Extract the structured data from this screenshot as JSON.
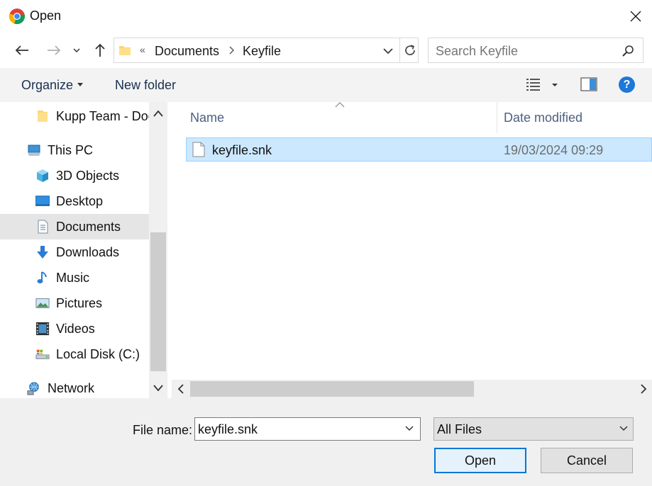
{
  "window": {
    "title": "Open",
    "app_icon": "chrome-icon",
    "close_icon": "close-icon"
  },
  "navigation": {
    "back_icon": "back-arrow-icon",
    "forward_icon": "forward-arrow-icon",
    "recent_icon": "chevron-down-icon",
    "up_icon": "up-arrow-icon"
  },
  "address": {
    "overflow": "«",
    "crumbs": [
      "Documents",
      "Keyfile"
    ],
    "refresh_icon": "refresh-icon"
  },
  "search": {
    "placeholder": "Search Keyfile"
  },
  "toolbar": {
    "organize_label": "Organize",
    "new_folder_label": "New folder",
    "help_label": "?"
  },
  "sidebar": {
    "items": [
      {
        "label": "Kupp Team - Documents",
        "icon": "folder-icon"
      },
      {
        "label": "This PC",
        "icon": "computer-icon"
      },
      {
        "label": "3D Objects",
        "icon": "cube-icon"
      },
      {
        "label": "Desktop",
        "icon": "desktop-icon"
      },
      {
        "label": "Documents",
        "icon": "document-icon",
        "selected": true
      },
      {
        "label": "Downloads",
        "icon": "download-arrow-icon"
      },
      {
        "label": "Music",
        "icon": "music-note-icon"
      },
      {
        "label": "Pictures",
        "icon": "picture-icon"
      },
      {
        "label": "Videos",
        "icon": "film-icon"
      },
      {
        "label": "Local Disk (C:)",
        "icon": "disk-drive-icon"
      },
      {
        "label": "Network",
        "icon": "network-icon"
      }
    ]
  },
  "files": {
    "columns": [
      "Name",
      "Date modified"
    ],
    "rows": [
      {
        "name": "keyfile.snk",
        "date_modified": "19/03/2024 09:29",
        "selected": true
      }
    ]
  },
  "footer": {
    "file_name_label": "File name:",
    "file_name_value": "keyfile.snk",
    "filter_value": "All Files",
    "open_label": "Open",
    "cancel_label": "Cancel"
  },
  "colors": {
    "selection_bg": "#cce8ff",
    "selection_border": "#99d1ff",
    "accent": "#0078d7",
    "toolbar_bg": "#f3f3f3",
    "footer_bg": "#f0f0f0"
  }
}
